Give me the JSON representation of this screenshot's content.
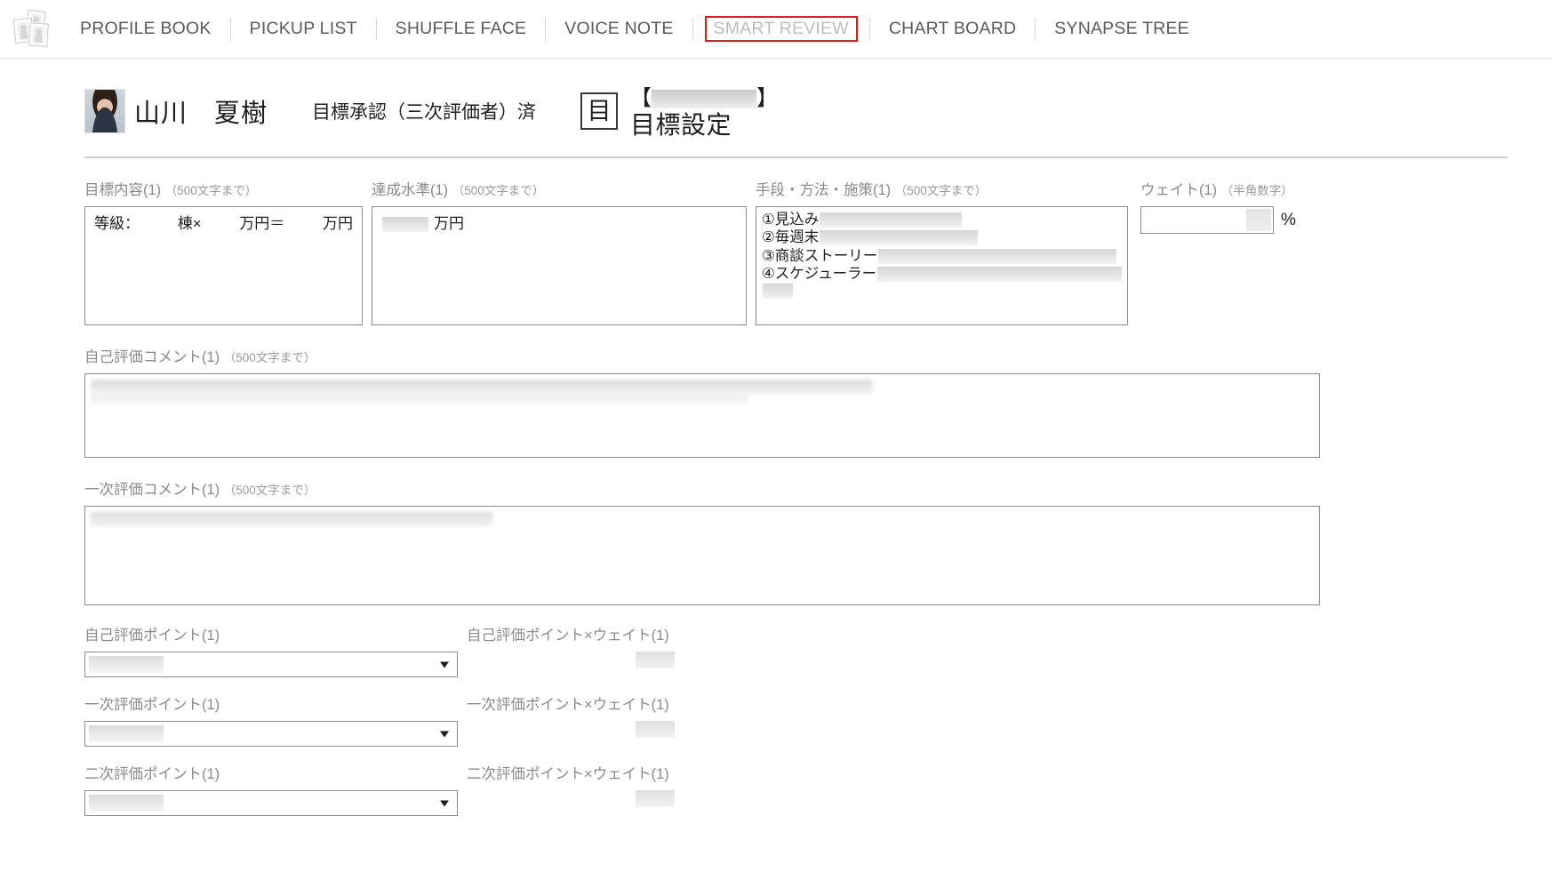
{
  "nav": {
    "logo_icon": "photo-stack-logo",
    "items": [
      {
        "label": "PROFILE BOOK",
        "active": false
      },
      {
        "label": "PICKUP LIST",
        "active": false
      },
      {
        "label": "SHUFFLE FACE",
        "active": false
      },
      {
        "label": "VOICE NOTE",
        "active": false
      },
      {
        "label": "SMART REVIEW",
        "active": true
      },
      {
        "label": "CHART BOARD",
        "active": false
      },
      {
        "label": "SYNAPSE TREE",
        "active": false
      }
    ],
    "active_outline_color": "#e01b1b",
    "active_text_color": "#bdbdbd"
  },
  "header": {
    "avatar_icon": "user-photo-avatar",
    "person_name": "山川　夏樹",
    "status_text": "目標承認（三次評価者）済",
    "doc_icon_glyph": "目",
    "bracket_open": "【",
    "bracket_close": "】",
    "bracket_redacted": true,
    "page_title": "目標設定"
  },
  "goal_section": {
    "fields": [
      {
        "label": "目標内容(1)",
        "note": "（500文字まで）",
        "value_prefix": "等級：",
        "value_parts": [
          "棟×",
          "万円＝",
          "万円"
        ]
      },
      {
        "label": "達成水準(1)",
        "note": "（500文字まで）",
        "value_suffix": "万円"
      },
      {
        "label": "手段・方法・施策(1)",
        "note": "（500文字まで）",
        "lines": [
          {
            "marker": "①",
            "text": "見込み",
            "redact_width": 160
          },
          {
            "marker": "②",
            "text": "毎週末",
            "redact_width": 178
          },
          {
            "marker": "③",
            "text": "商談ストーリー",
            "redact_width": 268
          },
          {
            "marker": "④",
            "text": "スケジューラー",
            "redact_width": 276
          },
          {
            "marker": "",
            "text": "",
            "redact_width": 34
          }
        ]
      }
    ],
    "weight": {
      "label": "ウェイト(1)",
      "note": "（半角数字）",
      "value": "",
      "unit": "%"
    }
  },
  "comments": [
    {
      "label": "自己評価コメント(1)",
      "note": "（500文字まで）",
      "value": "",
      "redacted": true
    },
    {
      "label": "一次評価コメント(1)",
      "note": "（500文字まで）",
      "value": "",
      "redacted": true
    }
  ],
  "points": [
    {
      "select_label": "自己評価ポイント(1)",
      "select_value": "",
      "select_caret_icon": "chevron-down-icon",
      "result_label": "自己評価ポイント×ウェイト(1)",
      "result_value": ""
    },
    {
      "select_label": "一次評価ポイント(1)",
      "select_value": "",
      "select_caret_icon": "chevron-down-icon",
      "result_label": "一次評価ポイント×ウェイト(1)",
      "result_value": ""
    },
    {
      "select_label": "二次評価ポイント(1)",
      "select_value": "",
      "select_caret_icon": "chevron-down-icon",
      "result_label": "二次評価ポイント×ウェイト(1)",
      "result_value": ""
    }
  ]
}
